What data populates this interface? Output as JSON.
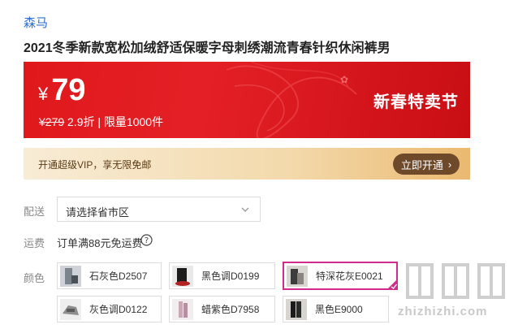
{
  "product": {
    "brand": "森马",
    "title": "2021冬季新款宽松加绒舒适保暖字母刺绣潮流青春针织休闲裤男"
  },
  "price_banner": {
    "currency": "¥",
    "price": "79",
    "original_price": "¥279",
    "discount": "2.9折",
    "separator": "|",
    "limit": "限量1000件",
    "festival": "新春特卖节"
  },
  "vip": {
    "text": "开通超级VIP，享无限免邮",
    "button": "立即开通"
  },
  "delivery": {
    "label": "配送",
    "placeholder": "请选择省市区"
  },
  "shipping_fee": {
    "label": "运费",
    "text": "订单满88元免运费"
  },
  "colors": {
    "label": "颜色",
    "options": [
      {
        "name": "石灰色D2507",
        "selected": false
      },
      {
        "name": "黑色调D0199",
        "selected": false
      },
      {
        "name": "特深花灰E0021",
        "selected": true
      },
      {
        "name": "灰色调D0122",
        "selected": false
      },
      {
        "name": "蜡紫色D7958",
        "selected": false
      },
      {
        "name": "黑色E9000",
        "selected": false
      }
    ]
  },
  "watermark": {
    "text": "zhizhizhi.com"
  }
}
